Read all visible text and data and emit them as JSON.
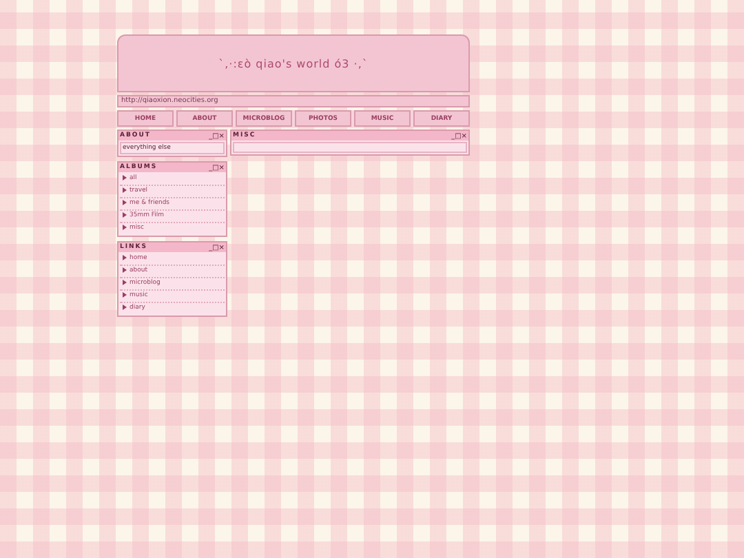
{
  "header": {
    "title": "`,·:εò qiao's world ó3 ·,`"
  },
  "url_bar": {
    "text": "http://qiaoxion.neocities.org"
  },
  "nav": [
    {
      "label": "HOME"
    },
    {
      "label": "ABOUT"
    },
    {
      "label": "MICROBLOG"
    },
    {
      "label": "PHOTOS"
    },
    {
      "label": "MUSIC"
    },
    {
      "label": "DIARY"
    }
  ],
  "sidebar": [
    {
      "title": "ABOUT",
      "controls": "_□×",
      "kind": "text",
      "text": "everything else"
    },
    {
      "title": "ALBUMS",
      "controls": "_□×",
      "kind": "list",
      "items": [
        "all",
        "travel",
        "me & friends",
        "35mm Film",
        "misc"
      ]
    },
    {
      "title": "LINKS",
      "controls": "_□×",
      "kind": "list",
      "items": [
        "home",
        "about",
        "microblog",
        "music",
        "diary"
      ]
    }
  ],
  "main": {
    "title": "MISC",
    "controls": "_□×"
  }
}
